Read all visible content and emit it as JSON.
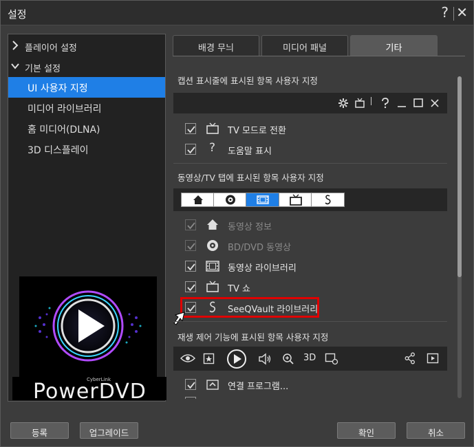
{
  "window": {
    "title": "설정",
    "help_label": "?",
    "close_label": "✕"
  },
  "sidebar": {
    "groups": [
      {
        "label": "플레이어 설정"
      },
      {
        "label": "기본 설정"
      }
    ],
    "items": [
      {
        "label": "UI 사용자 지정"
      },
      {
        "label": "미디어 라이브러리"
      },
      {
        "label": "홈 미디어(DLNA)"
      },
      {
        "label": "3D 디스플레이"
      }
    ],
    "logo": {
      "brand": "CyberLink",
      "product": "PowerDVD"
    }
  },
  "tabs": [
    {
      "label": "배경 무늬"
    },
    {
      "label": "미디어 패널"
    },
    {
      "label": "기타"
    }
  ],
  "caption_section": {
    "title": "캡션 표시줄에 표시된 항목 사용자 지정",
    "items": [
      {
        "label": "TV 모드로 전환",
        "icon": "tv-icon"
      },
      {
        "label": "도움말 표시",
        "icon": "help-icon",
        "icon_glyph": "?"
      }
    ]
  },
  "movie_tv_section": {
    "title": "동영상/TV 탭에 표시된 항목 사용자 지정",
    "items": [
      {
        "label": "동영상 정보",
        "icon": "home-icon"
      },
      {
        "label": "BD/DVD 동영상",
        "icon": "disc-icon"
      },
      {
        "label": "동영상 라이브러리",
        "icon": "film-icon"
      },
      {
        "label": "TV 쇼",
        "icon": "tv-icon"
      },
      {
        "label": "SeeQVault 라이브러리",
        "icon": "seeqvault-icon"
      }
    ]
  },
  "playback_section": {
    "title": "재생 제어 기능에 표시된 항목 사용자 지정",
    "three_d_label": "3D",
    "items": [
      {
        "label": "연결 프로그램...",
        "icon": "open-with-icon"
      }
    ]
  },
  "footer": {
    "register_label": "등록",
    "upgrade_label": "업그레이드",
    "ok_label": "확인",
    "cancel_label": "취소"
  },
  "colors": {
    "accent": "#1f7fe6",
    "highlight": "#e00000"
  }
}
